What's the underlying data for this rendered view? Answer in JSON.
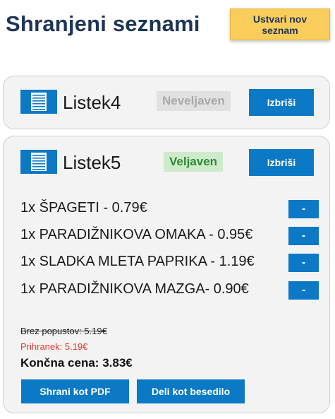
{
  "header": {
    "title": "Shranjeni seznami",
    "create_button": "Ustvari nov seznam"
  },
  "colors": {
    "primary": "#0b79c5",
    "accent": "#f9cd5c",
    "title": "#1d3557",
    "valid": "#2f8a34",
    "invalid": "#a9a9a9",
    "savings": "#e33a2a"
  },
  "lists": [
    {
      "icon": "list-icon",
      "name": "Listek4",
      "status": "Neveljaven",
      "delete_label": "Izbriši"
    },
    {
      "icon": "list-icon",
      "name": "Listek5",
      "status": "Veljaven",
      "delete_label": "Izbriši",
      "items": [
        {
          "text": "1x ŠPAGETI - 0.79€",
          "remove_label": "-"
        },
        {
          "text": "1x PARADIŽNIKOVA OMAKA - 0.95€",
          "remove_label": "-"
        },
        {
          "text": "1x SLADKA MLETA PAPRIKA - 1.19€",
          "remove_label": "-"
        },
        {
          "text": "1x PARADIŽNIKOVA MAZGA- 0.90€",
          "remove_label": "-"
        }
      ],
      "price_without_discount": "Brez popustov: 5.19€",
      "savings": "Prihranek: 5.19€",
      "final_price": "Končna cena: 3.83€",
      "save_pdf_label": "Shrani kot PDF",
      "share_text_label": "Deli kot besedilo"
    }
  ]
}
